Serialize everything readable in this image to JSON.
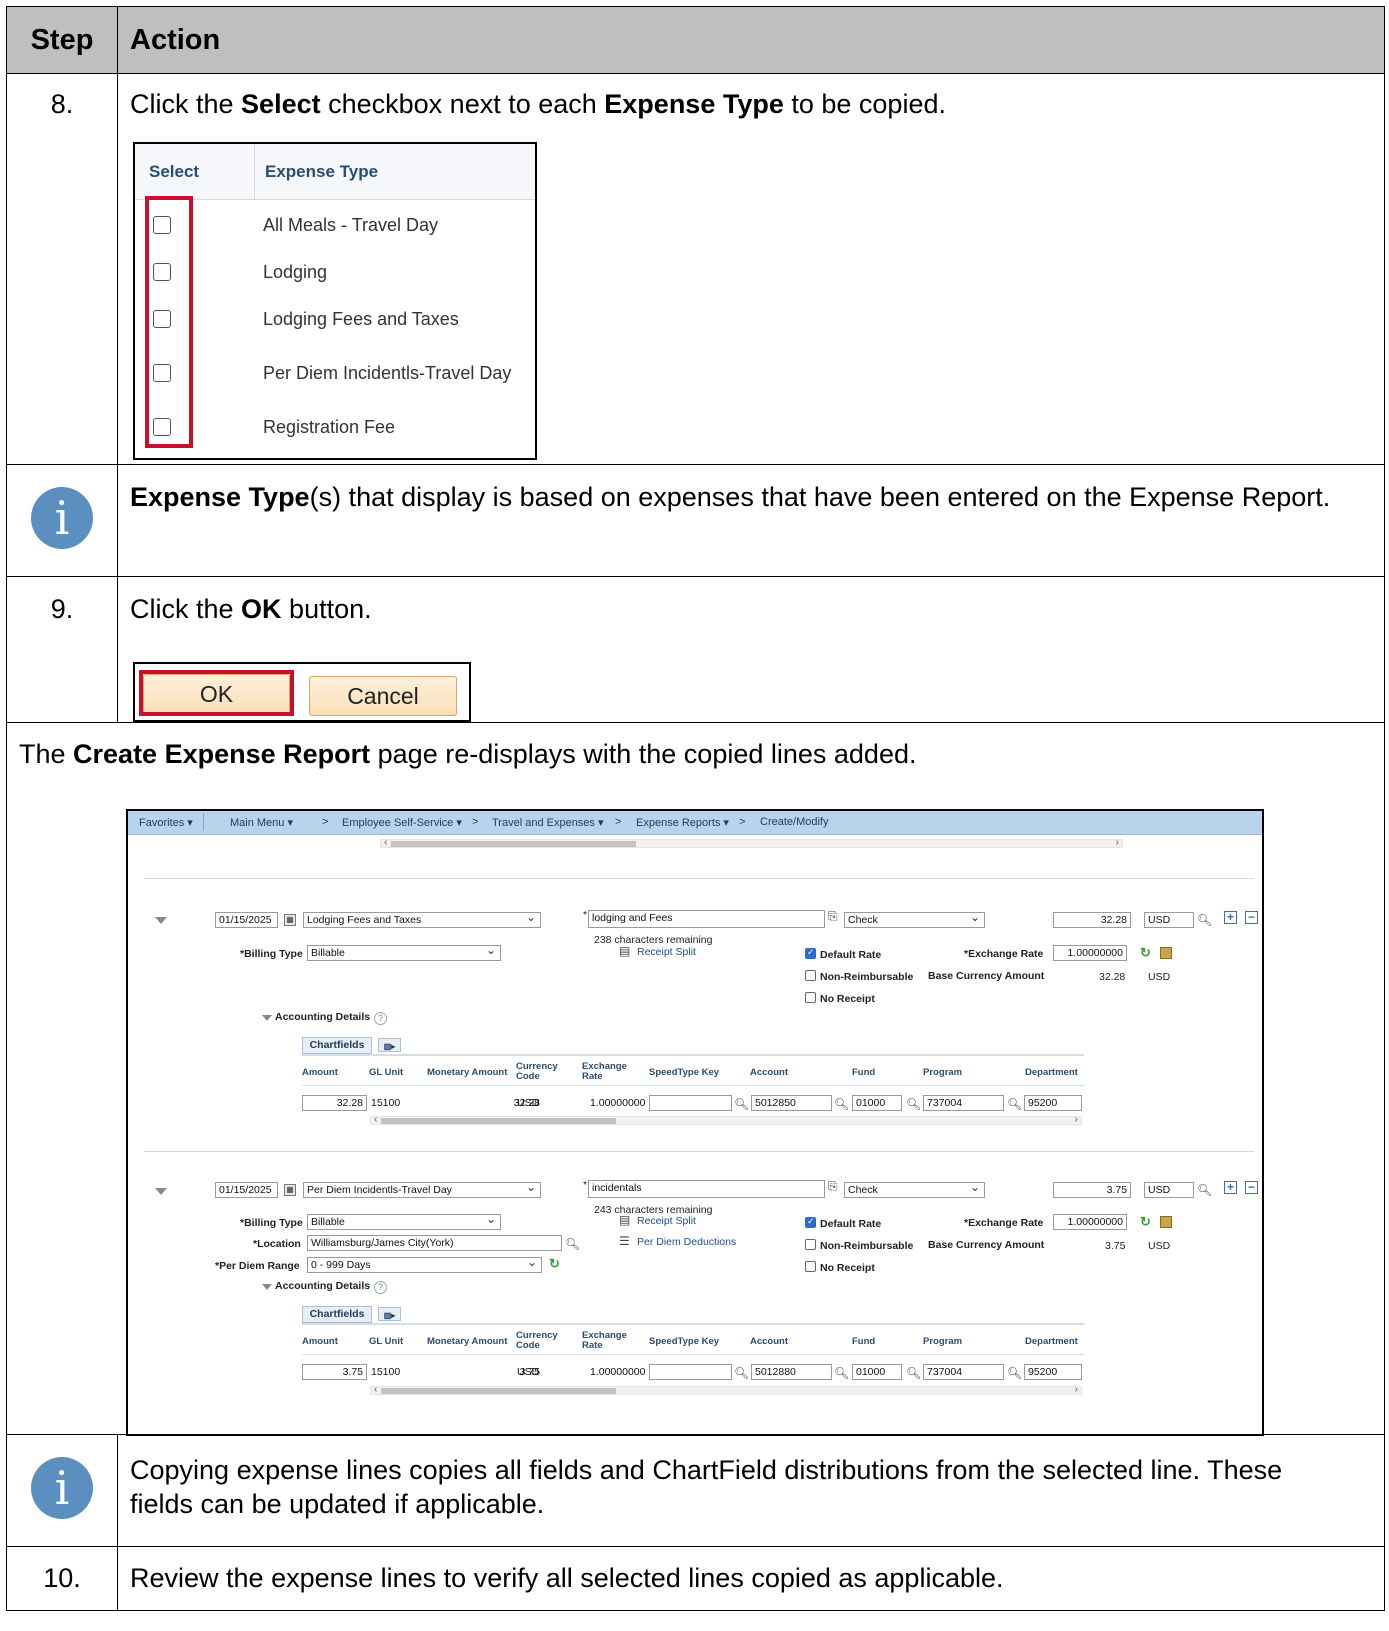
{
  "table": {
    "header_step": "Step",
    "header_action": "Action"
  },
  "step8": {
    "number": "8.",
    "text_pre": "Click the ",
    "text_b1": "Select",
    "text_mid": " checkbox next to each ",
    "text_b2": "Expense Type",
    "text_post": " to be copied.",
    "select_header": "Select",
    "expense_type_header": "Expense Type",
    "expense_types": [
      "All Meals - Travel Day",
      "Lodging",
      "Lodging Fees and Taxes",
      "Per Diem Incidentls-Travel Day",
      "Registration Fee"
    ]
  },
  "info1": {
    "bold": "Expense Type",
    "rest": "(s) that display is based on expenses that have been entered on the Expense Report."
  },
  "step9": {
    "number": "9.",
    "text_pre": "Click the ",
    "text_b": "OK",
    "text_post": " button.",
    "ok_label": "OK",
    "cancel_label": "Cancel"
  },
  "redisplay": {
    "pre": "The ",
    "bold": "Create Expense Report",
    "post": " page re-displays with the copied lines added."
  },
  "screenshot": {
    "nav": [
      "Favorites ▾",
      "Main Menu ▾",
      ">",
      "Employee Self-Service ▾",
      ">",
      "Travel and Expenses ▾",
      ">",
      "Expense Reports ▾",
      ">",
      "Create/Modify"
    ],
    "lines": [
      {
        "date": "01/15/2025",
        "expense_type": "Lodging Fees and Taxes",
        "description": "lodging and Fees",
        "chars_remaining": "238 characters remaining",
        "payment_type": "Check",
        "amount": "32.28",
        "currency": "USD",
        "billing_type_label": "*Billing Type",
        "billing_type": "Billable",
        "receipt_split": "Receipt Split",
        "default_rate": "Default Rate",
        "exchange_rate_label": "*Exchange Rate",
        "exchange_rate": "1.00000000",
        "non_reimbursable": "Non-Reimbursable",
        "base_currency_label": "Base Currency Amount",
        "base_currency_amount": "32.28",
        "base_currency": "USD",
        "no_receipt": "No Receipt",
        "accounting_details": "Accounting Details",
        "chartfields_tab": "Chartfields",
        "grid_headers": [
          "Amount",
          "GL Unit",
          "Monetary Amount",
          "Currency Code",
          "Exchange Rate",
          "SpeedType Key",
          "Account",
          "Fund",
          "Program",
          "Department"
        ],
        "grid_row": {
          "amount": "32.28",
          "gl_unit": "15100",
          "monetary_amount": "32.28",
          "currency_code": "USD",
          "exchange_rate": "1.00000000",
          "speedtype": "",
          "account": "5012850",
          "fund": "01000",
          "program": "737004",
          "department": "95200"
        }
      },
      {
        "date": "01/15/2025",
        "expense_type": "Per Diem Incidentls-Travel Day",
        "description": "incidentals",
        "chars_remaining": "243 characters remaining",
        "payment_type": "Check",
        "amount": "3.75",
        "currency": "USD",
        "billing_type_label": "*Billing Type",
        "billing_type": "Billable",
        "location_label": "*Location",
        "location": "Williamsburg/James City(York)",
        "per_diem_range_label": "*Per Diem Range",
        "per_diem_range": "0 - 999  Days",
        "receipt_split": "Receipt Split",
        "per_diem_deductions": "Per Diem Deductions",
        "default_rate": "Default Rate",
        "exchange_rate_label": "*Exchange Rate",
        "exchange_rate": "1.00000000",
        "non_reimbursable": "Non-Reimbursable",
        "base_currency_label": "Base Currency Amount",
        "base_currency_amount": "3.75",
        "base_currency": "USD",
        "no_receipt": "No Receipt",
        "accounting_details": "Accounting Details",
        "chartfields_tab": "Chartfields",
        "grid_headers": [
          "Amount",
          "GL Unit",
          "Monetary Amount",
          "Currency Code",
          "Exchange Rate",
          "SpeedType Key",
          "Account",
          "Fund",
          "Program",
          "Department"
        ],
        "grid_row": {
          "amount": "3.75",
          "gl_unit": "15100",
          "monetary_amount": "3.75",
          "currency_code": "USD",
          "exchange_rate": "1.00000000",
          "speedtype": "",
          "account": "5012880",
          "fund": "01000",
          "program": "737004",
          "department": "95200"
        }
      }
    ]
  },
  "info2": {
    "text": "Copying expense lines copies all fields and ChartField distributions from the selected line. These fields can be updated if applicable."
  },
  "step10": {
    "number": "10.",
    "text": "Review the expense lines to verify all selected lines copied as applicable."
  },
  "colors": {
    "header_bg": "#bfbfbf",
    "highlight_red": "#c8102e",
    "info_icon": "#5b8fc0",
    "nav_bar": "#b9d3ec"
  }
}
